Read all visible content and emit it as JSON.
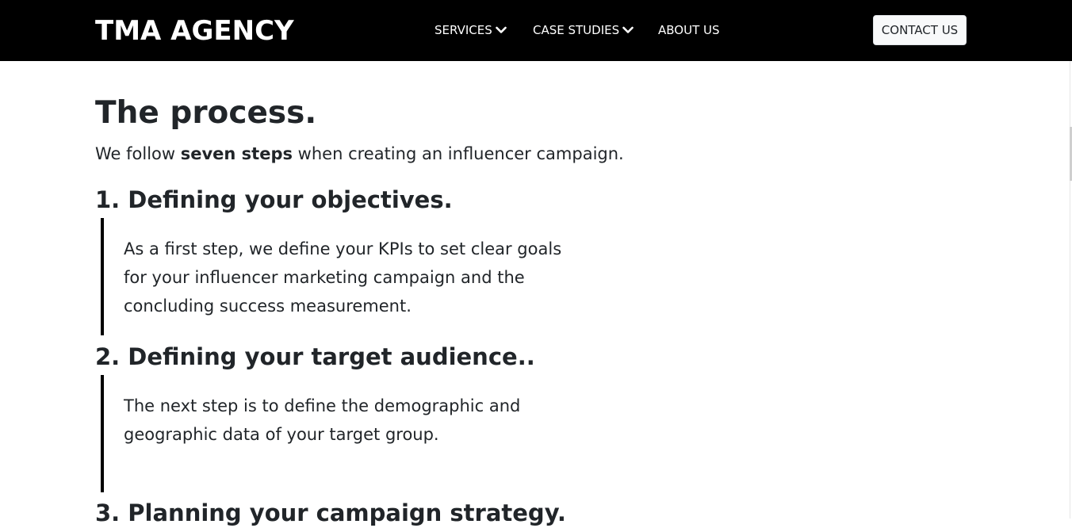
{
  "nav": {
    "brand": "TMA AGENCY",
    "items": [
      {
        "label": "SERVICES",
        "has_dropdown": true
      },
      {
        "label": "CASE STUDIES",
        "has_dropdown": true
      },
      {
        "label": "ABOUT US",
        "has_dropdown": false
      }
    ],
    "contact_label": "CONTACT US"
  },
  "main": {
    "title": "The process.",
    "intro_before": "We follow ",
    "intro_bold": "seven steps",
    "intro_after": " when creating an influencer campaign.",
    "steps": [
      {
        "heading": "1. Defining your objectives.",
        "text": "As a first step, we define your KPIs to set clear goals for your influencer marketing campaign and the concluding success measurement."
      },
      {
        "heading": "2. Defining your target audience..",
        "text": "The next step is to define the demographic and geographic data of your target group."
      },
      {
        "heading": "3. Planning your campaign strategy."
      }
    ]
  },
  "colors": {
    "navbar_bg": "#000000",
    "text": "#212529",
    "button_bg": "#f8f9fa"
  }
}
